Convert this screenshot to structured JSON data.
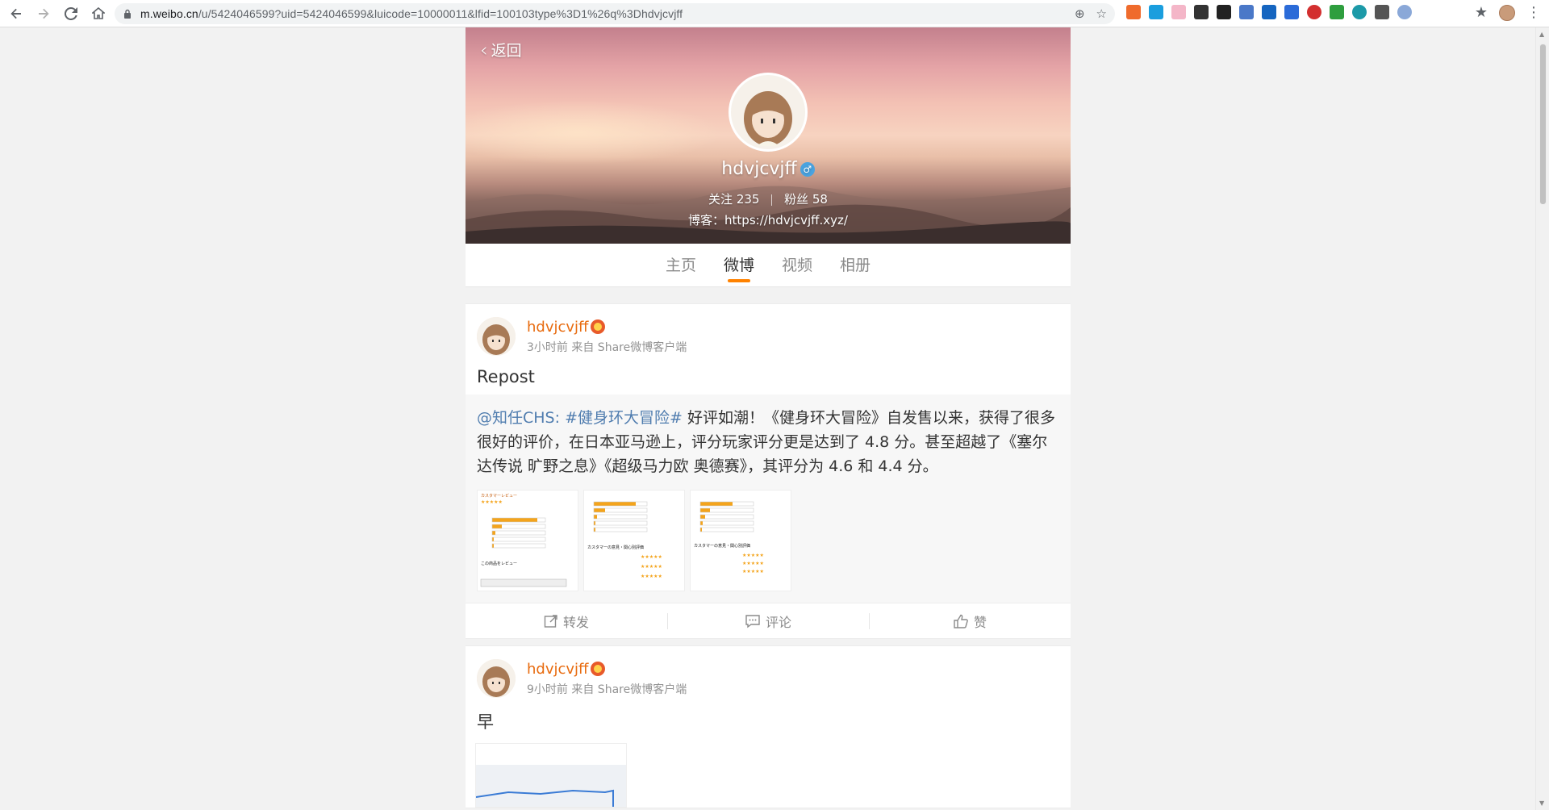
{
  "browser": {
    "url_host": "m.weibo.cn",
    "url_path": "/u/5424046599?uid=5424046599&luicode=10000011&lfid=100103type%3D1%26q%3Dhdvjcvjff"
  },
  "profile": {
    "back_label": "返回",
    "username": "hdvjcvjff",
    "gender_icon": "male-icon",
    "following_label": "关注",
    "following_count": "235",
    "followers_label": "粉丝",
    "followers_count": "58",
    "blog_text": "博客：https://hdvjcvjff.xyz/"
  },
  "tabs": [
    {
      "label": "主页"
    },
    {
      "label": "微博",
      "active": true
    },
    {
      "label": "视频"
    },
    {
      "label": "相册"
    }
  ],
  "posts": [
    {
      "author": "hdvjcvjff",
      "meta": "3小时前 来自 Share微博客户端",
      "text": "Repost",
      "repost": {
        "mention": "@知任CHS:",
        "hashtag": "#健身环大冒险#",
        "body": " 好评如潮！《健身环大冒险》自发售以来，获得了很多很好的评价，在日本亚马逊上，评分玩家评分更是达到了 4.8 分。甚至超越了《塞尔达传说 旷野之息》《超级马力欧 奥德赛》，其评分为 4.6 和 4.4 分。",
        "images": 3
      },
      "actions": {
        "repost": "转发",
        "comment": "评论",
        "like": "赞"
      }
    },
    {
      "author": "hdvjcvjff",
      "meta": "9小时前 来自 Share微博客户端",
      "text": "早"
    }
  ],
  "colors": {
    "accent": "#ff8200",
    "name": "#e86b0f",
    "link": "#507daf"
  }
}
